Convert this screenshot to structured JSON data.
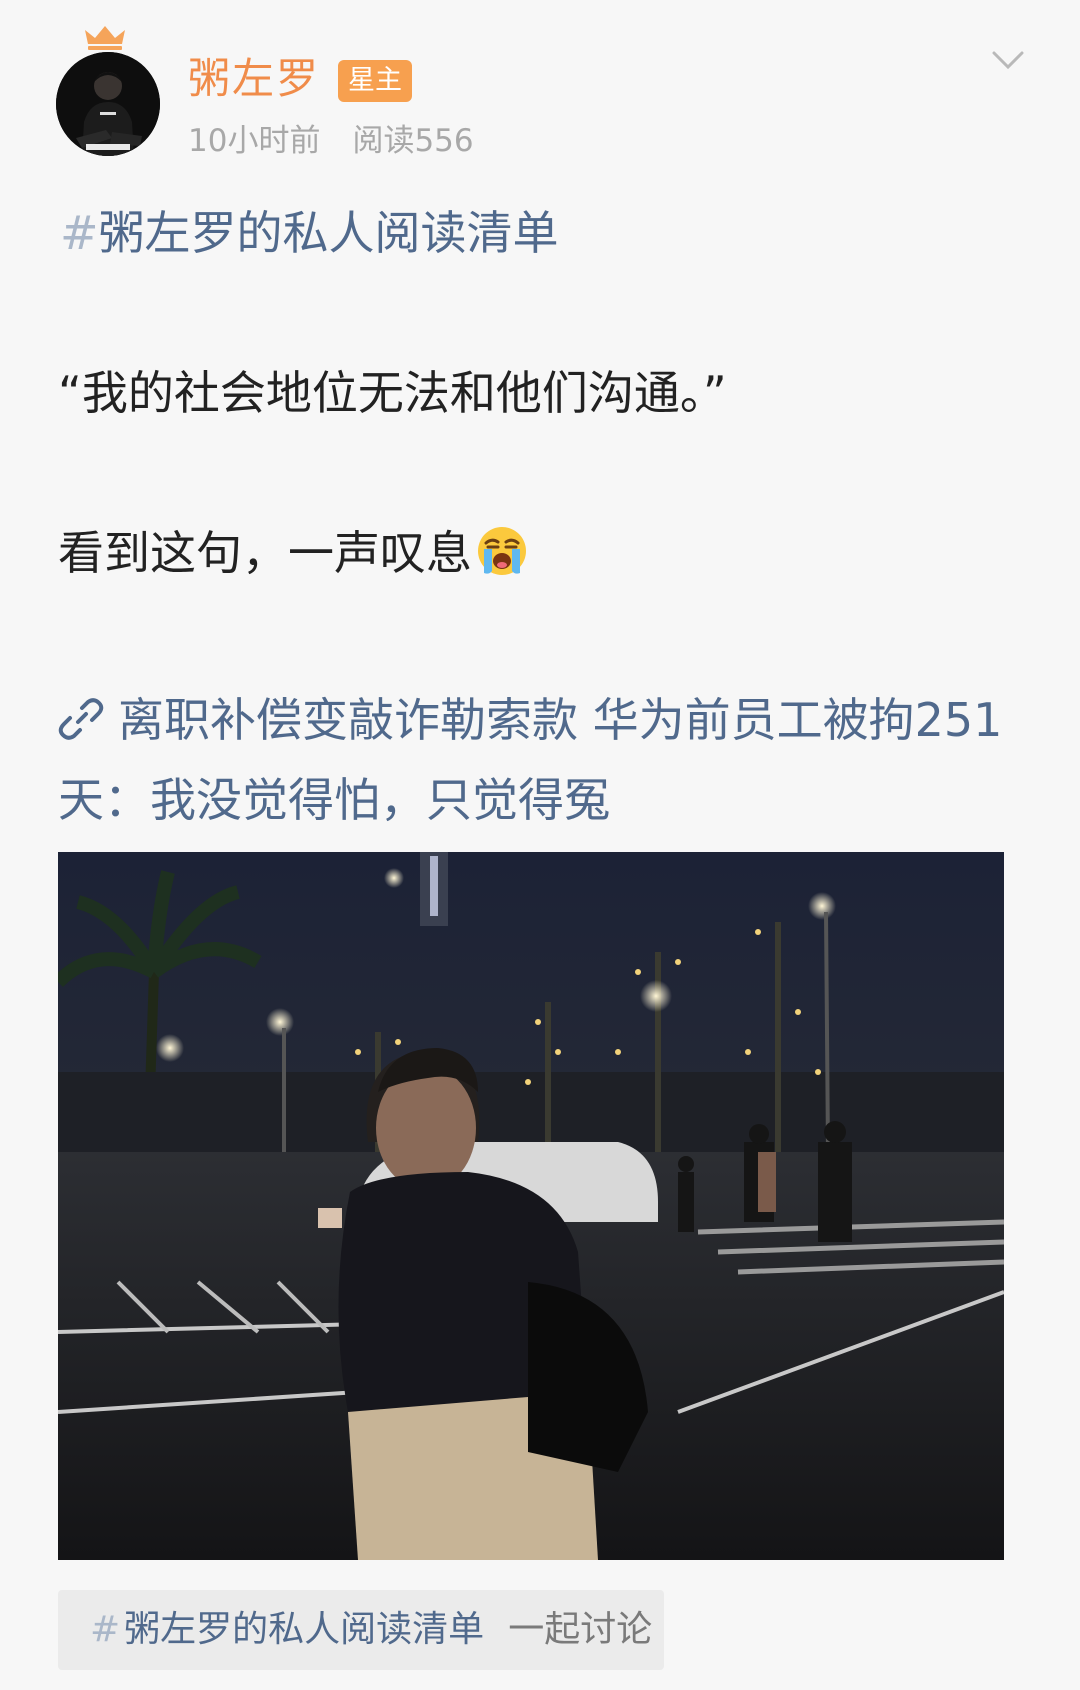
{
  "header": {
    "username": "粥左罗",
    "badge": "星主",
    "time": "10小时前",
    "reads": "阅读556"
  },
  "post": {
    "hashtag_mark": "#",
    "hashtag": "粥左罗的私人阅读清单",
    "quote": "“我的社会地位无法和他们沟通。”",
    "sentence": "看到这句，一声叹息",
    "emoji": "loudly-crying-face",
    "link_text": "离职补偿变敲诈勒索款 华为前员工被拘251天：我没觉得怕，只觉得冤"
  },
  "topic_chip": {
    "hash_mark": "#",
    "label": "粥左罗的私人阅读清单",
    "action": "一起讨论"
  },
  "colors": {
    "username": "#f08c4a",
    "badge_bg": "#f7a04f",
    "link": "#50698c",
    "meta": "#a8a8a8",
    "background": "#f7f7f7"
  }
}
